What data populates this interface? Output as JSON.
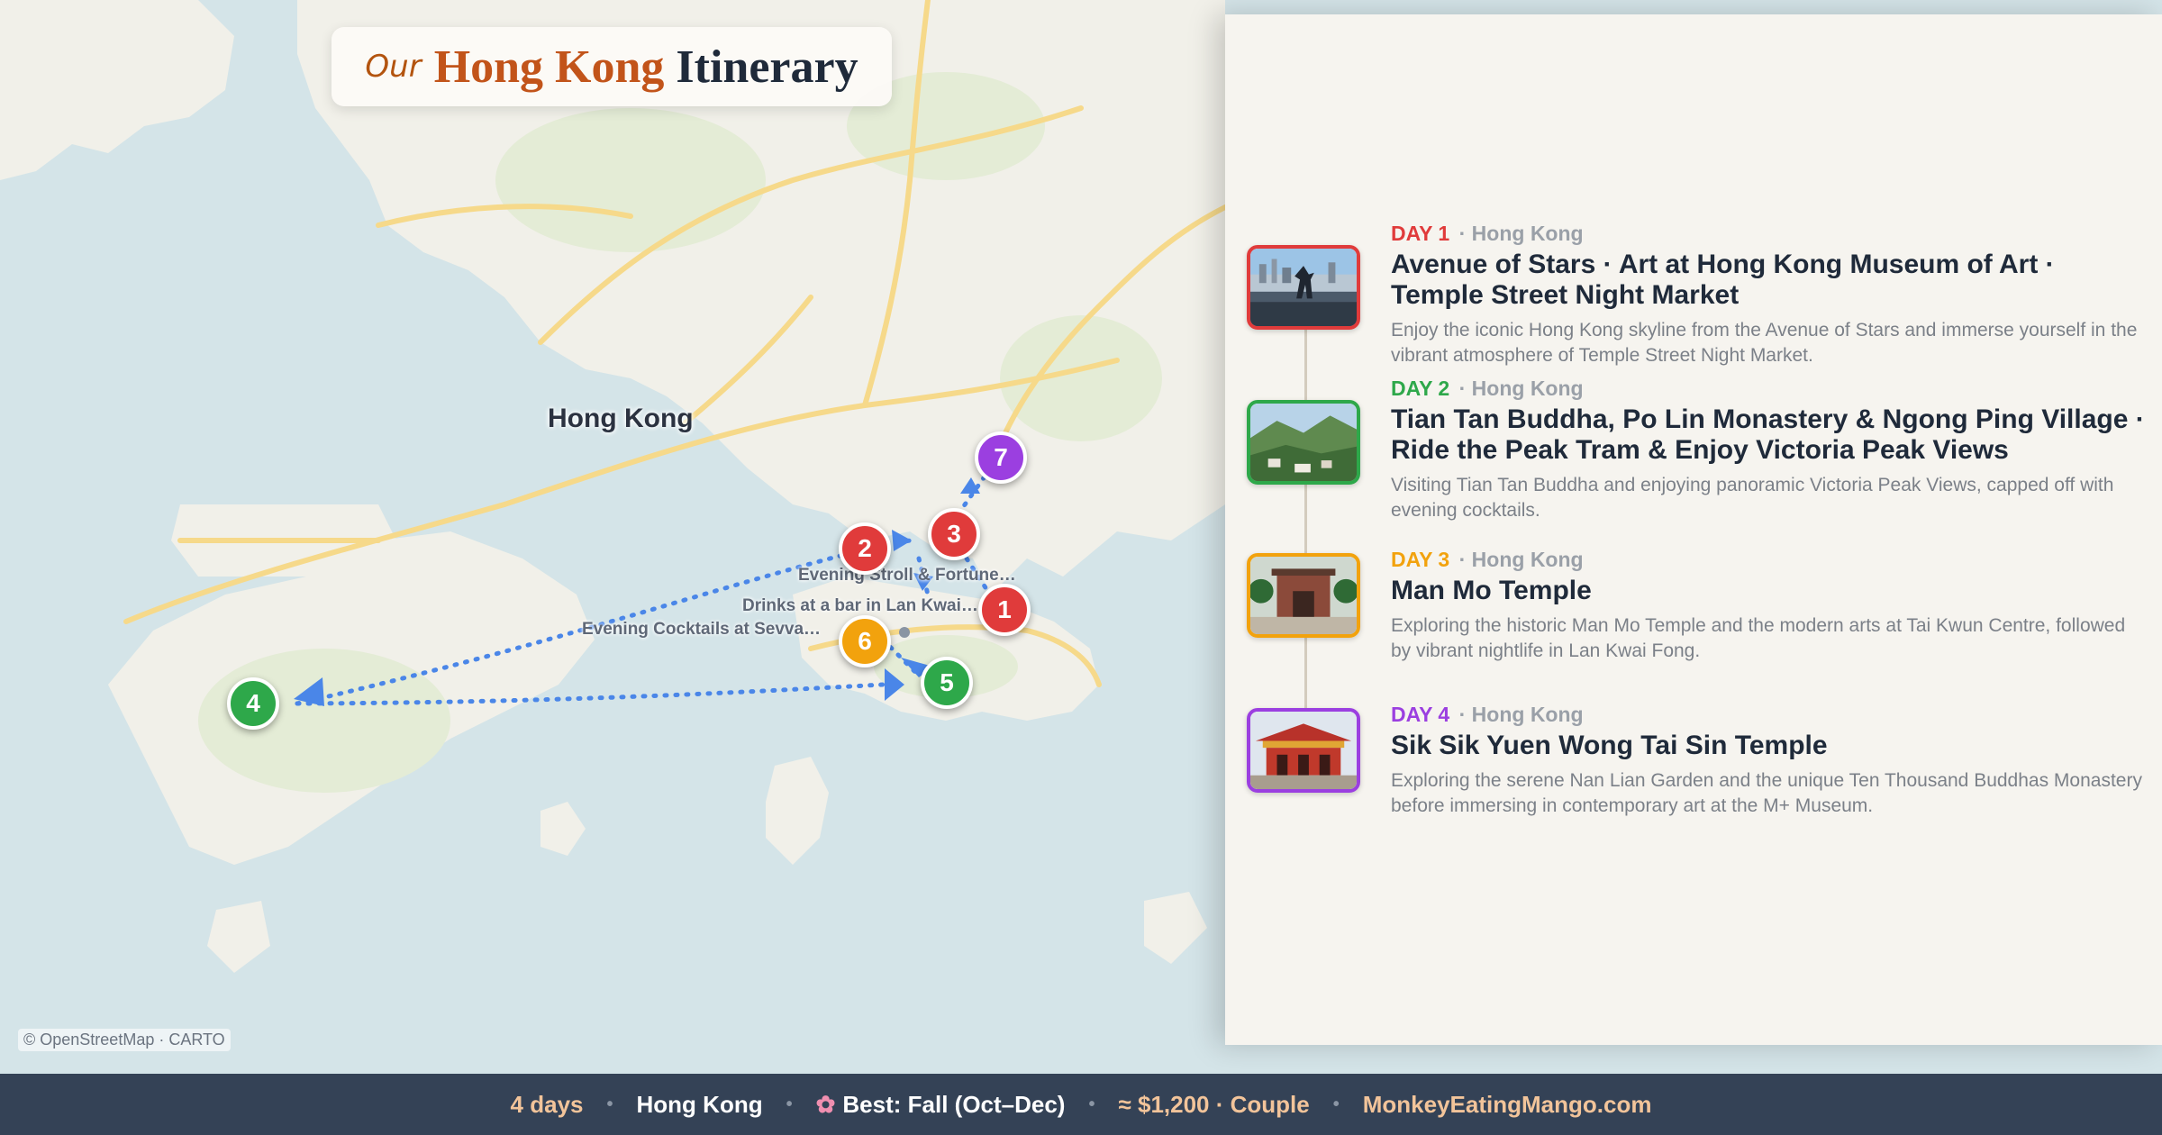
{
  "title": {
    "prefix": "Our",
    "part1": "Hong Kong",
    "part2": "Itinerary"
  },
  "map": {
    "city_label": "Hong Kong",
    "attribution": "© OpenStreetMap · CARTO",
    "colors": {
      "water": "#d4e4e8",
      "land": "#f1f0e9",
      "park": "#e4ecd6",
      "road": "#f6d98a",
      "route": "#4a86e8"
    },
    "markers": [
      {
        "num": "1",
        "color": "#e03b3b"
      },
      {
        "num": "2",
        "color": "#e03b3b"
      },
      {
        "num": "3",
        "color": "#e03b3b"
      },
      {
        "num": "4",
        "color": "#2ea84a"
      },
      {
        "num": "5",
        "color": "#2ea84a"
      },
      {
        "num": "6",
        "color": "#f2a20d"
      },
      {
        "num": "7",
        "color": "#9b3fe0"
      }
    ],
    "stop_labels": [
      "Evening Stroll & Fortune…",
      "Drinks at a bar in Lan Kwai…",
      "Evening Cocktails at Sevva…"
    ]
  },
  "days": [
    {
      "day": "DAY 1",
      "place": "Hong Kong",
      "color": "#e03b3b",
      "image_icon": "harbour-statue-photo",
      "title": "Avenue of Stars · Art at Hong Kong Museum of Art · Temple Street Night Market",
      "desc": "Enjoy the iconic Hong Kong skyline from the Avenue of Stars and immerse yourself in the vibrant atmosphere of Temple Street Night Market."
    },
    {
      "day": "DAY 2",
      "place": "Hong Kong",
      "color": "#2ea84a",
      "image_icon": "mountain-village-photo",
      "title": "Tian Tan Buddha, Po Lin Monastery & Ngong Ping Village · Ride the Peak Tram & Enjoy Victoria Peak Views",
      "desc": "Visiting Tian Tan Buddha and enjoying panoramic Victoria Peak Views, capped off with evening cocktails."
    },
    {
      "day": "DAY 3",
      "place": "Hong Kong",
      "color": "#f2a20d",
      "image_icon": "temple-courtyard-photo",
      "title": "Man Mo Temple",
      "desc": "Exploring the historic Man Mo Temple and the modern arts at Tai Kwun Centre, followed by vibrant nightlife in Lan Kwai Fong."
    },
    {
      "day": "DAY 4",
      "place": "Hong Kong",
      "color": "#9b3fe0",
      "image_icon": "red-temple-photo",
      "title": "Sik Sik Yuen Wong Tai Sin Temple",
      "desc": "Exploring the serene Nan Lian Garden and the unique Ten Thousand Buddhas Monastery before immersing in contemporary art at the M+ Museum."
    }
  ],
  "footer": {
    "duration": "4 days",
    "destination": "Hong Kong",
    "best": "Best: Fall (Oct–Dec)",
    "budget": "≈ $1,200 · Couple",
    "site": "MonkeyEatingMango.com"
  }
}
